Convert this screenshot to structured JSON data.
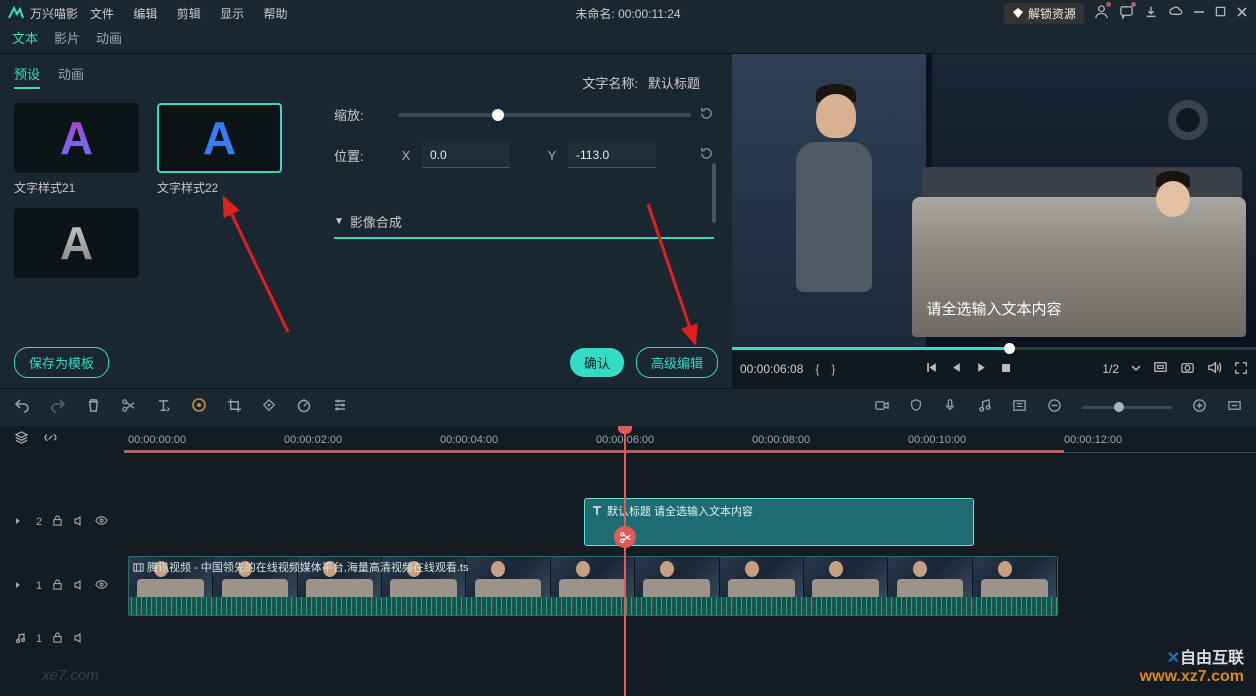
{
  "titlebar": {
    "appname": "万兴喵影",
    "menus": [
      "文件",
      "编辑",
      "剪辑",
      "显示",
      "帮助"
    ],
    "center": "未命名: 00:00:11:24",
    "unlock": "解锁资源"
  },
  "toptabs": [
    "文本",
    "影片",
    "动画"
  ],
  "toptab_active": 0,
  "subtabs": [
    "预设",
    "动画"
  ],
  "subtab_active": 0,
  "text_name_label": "文字名称:",
  "text_name_value": "默认标题",
  "presets": [
    {
      "label": "文字样式21",
      "color1": "#b83ccf",
      "color2": "#5a7cf2"
    },
    {
      "label": "文字样式22",
      "color1": "#2f74f2",
      "color2": "#2f74f2",
      "selected": true
    },
    {
      "label": "",
      "color1": "#b8bcc2",
      "color2": "#868a90"
    }
  ],
  "props": {
    "scale_label": "缩放:",
    "pos_label": "位置:",
    "x_label": "X",
    "x_value": "0.0",
    "y_label": "Y",
    "y_value": "-113.0",
    "compose_label": "影像合成"
  },
  "buttons": {
    "save_template": "保存为模板",
    "confirm": "确认",
    "adv_edit": "高级编辑"
  },
  "preview": {
    "subtitle": "请全选输入文本内容",
    "time": "00:00:06:08",
    "fraction": "1/2"
  },
  "ruler": [
    "00:00:00:00",
    "00:00:02:00",
    "00:00:04:00",
    "00:00:06:00",
    "00:00:08:00",
    "00:00:10:00",
    "00:00:12:00"
  ],
  "ruler_positions": [
    4,
    160,
    316,
    472,
    628,
    784,
    940
  ],
  "text_clip": {
    "title": "默认标题 请全选输入文本内容"
  },
  "video_clip": {
    "title": "腾讯视频 - 中国领先的在线视频媒体平台,海量高清视频在线观看.ts"
  },
  "track_labels": {
    "text": "2",
    "video": "1",
    "audio": "1"
  },
  "watermark": {
    "line1": "自由互联",
    "line2": "www.xz7.com"
  }
}
